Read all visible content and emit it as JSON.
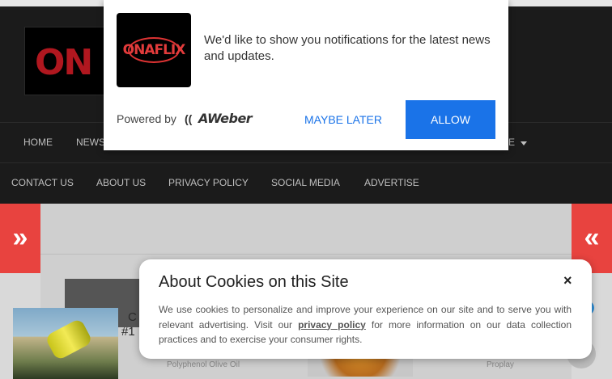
{
  "site": {
    "logo_text": "ON",
    "nav_row1": [
      "HOME",
      "NEWS"
    ],
    "nav_row2": [
      "CONTACT US",
      "ABOUT US",
      "PRIVACY POLICY",
      "SOCIAL MEDIA",
      "ADVERTISE"
    ],
    "nav_row1_end": "E",
    "left_tab_icon": "»",
    "right_tab_icon": "«",
    "thumb_label_1": "Polyphenol Olive Oil",
    "thumb_label_2": "Proplay",
    "promo_text_line1": "C",
    "promo_text_line2": "#1",
    "accent_color": "#e8433f"
  },
  "notification": {
    "logo_text": "ONAFLIX",
    "message": "We'd like to show you notifications for the latest news and updates.",
    "powered_by": "Powered by",
    "provider_icon": "((",
    "provider": "AWeber",
    "later_label": "MAYBE LATER",
    "allow_label": "ALLOW",
    "allow_color": "#1a73e8"
  },
  "cookie": {
    "title": "About Cookies on this Site",
    "close_icon": "×",
    "body_before": "We use cookies to personalize and improve your experience on our site and to serve you with relevant advertising. Visit our ",
    "link_text": "privacy policy",
    "body_after": " for more information on our data collection practices and to exercise your consumer rights."
  }
}
